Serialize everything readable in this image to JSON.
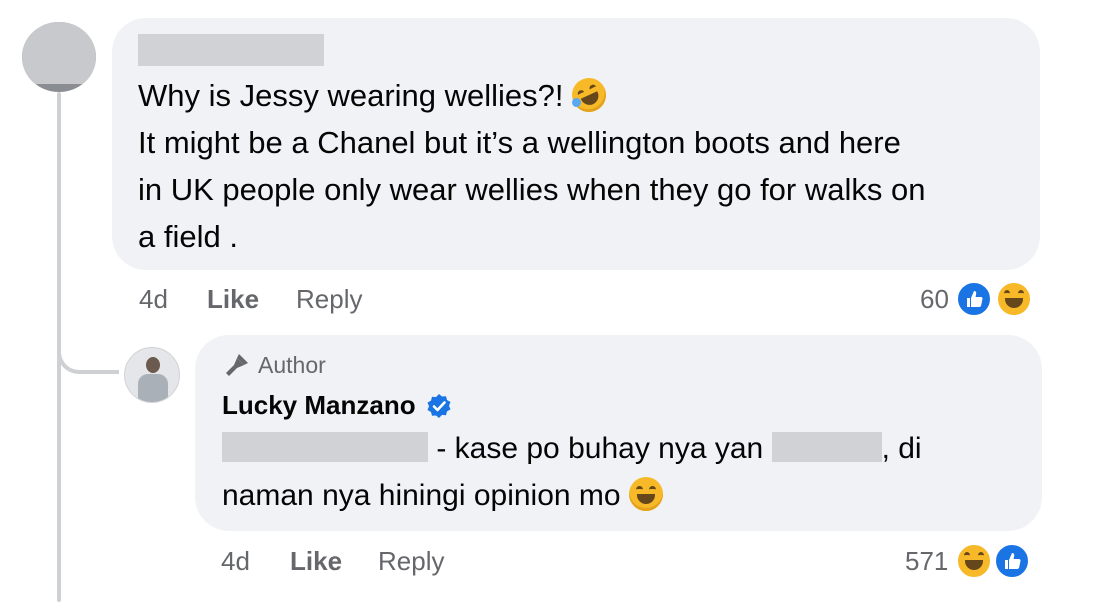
{
  "main_comment": {
    "lines": [
      "Why is Jessy wearing wellies?!",
      "It might be a Chanel but it’s a wellington boots and here",
      "in UK people only wear wellies when they go for walks on",
      "a field ."
    ],
    "time": "4d",
    "like_label": "Like",
    "reply_label": "Reply",
    "reaction_count": "60",
    "reactions": [
      "like",
      "haha"
    ]
  },
  "reply_comment": {
    "badge": "Author",
    "name": "Lucky Manzano",
    "verified": true,
    "text_part1": "- kase po buhay nya yan",
    "text_part2": ", di",
    "text_line2": "naman nya hiningi opinion mo",
    "time": "4d",
    "like_label": "Like",
    "reply_label": "Reply",
    "reaction_count": "571",
    "reactions": [
      "haha",
      "like"
    ]
  },
  "colors": {
    "bubble": "#f0f2f5",
    "meta_text": "#65676b",
    "like_blue": "#1b74e4",
    "haha_yellow": "#f7b928",
    "thread_line": "#ced0d4"
  }
}
